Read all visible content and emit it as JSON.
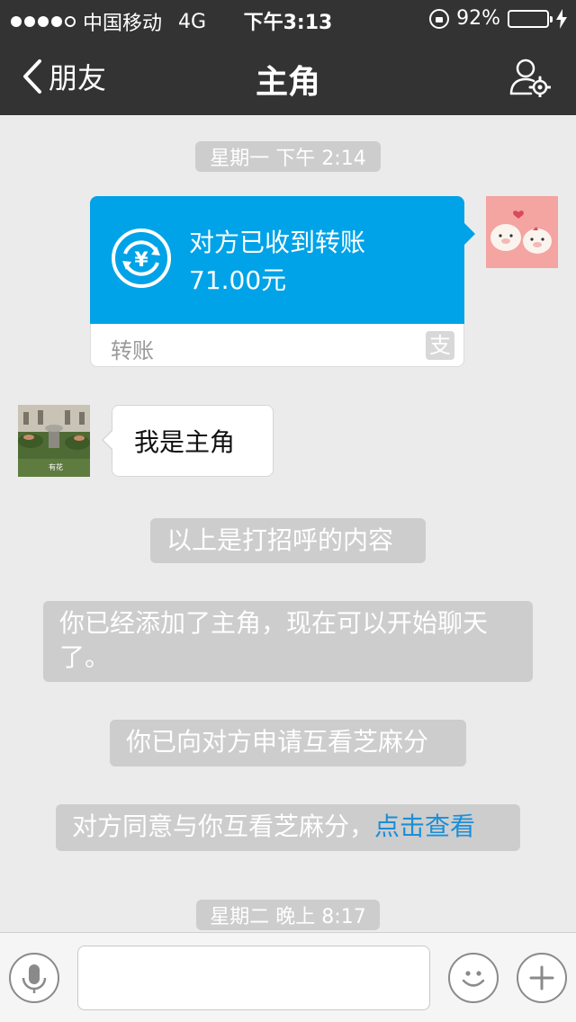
{
  "status_bar": {
    "carrier": "中国移动",
    "network": "4G",
    "time": "下午3:13",
    "battery_percent": "92%",
    "battery_level": 0.92,
    "signal_bars_filled": 4,
    "signal_bars_total": 5
  },
  "nav": {
    "back_label": "朋友",
    "title": "主角",
    "profile_icon": "person-gear-icon"
  },
  "messages": {
    "timestamp_1": "星期一 下午 2:14",
    "transfer": {
      "status": "对方已收到转账",
      "amount": "71.00元",
      "label": "转账",
      "brand_glyph": "支",
      "accent_color": "#00a3e7"
    },
    "chat_text": "我是主角",
    "system_1": "以上是打招呼的内容",
    "system_2": "你已经添加了主角，现在可以开始聊天了。",
    "system_3": "你已向对方申请互看芝麻分",
    "system_4_text": "对方同意与你互看芝麻分，",
    "system_4_link": "点击查看",
    "timestamp_2": "星期二 晚上 8:17",
    "avatar_caption": "有花"
  },
  "input_bar": {
    "text_value": "",
    "voice_icon": "microphone-icon",
    "emoji_icon": "smiley-icon",
    "plus_icon": "plus-icon"
  }
}
